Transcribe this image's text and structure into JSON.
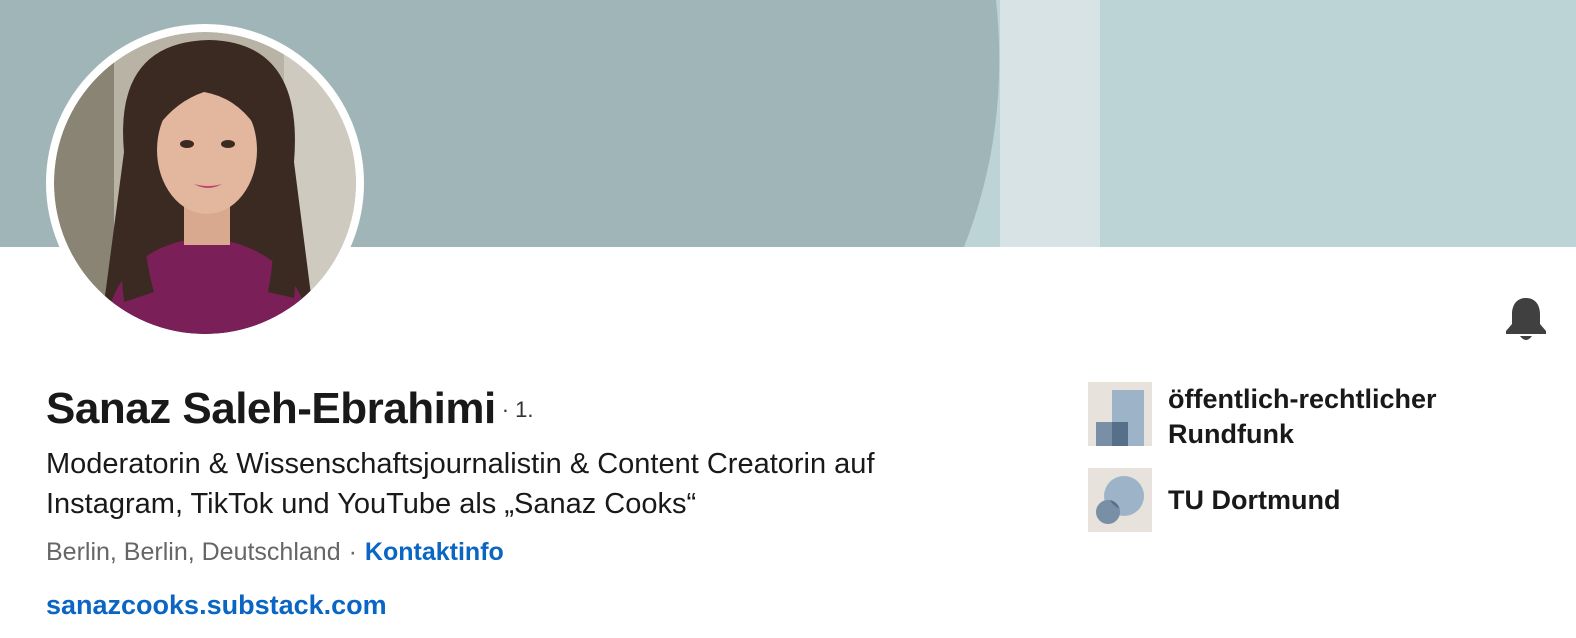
{
  "profile": {
    "name": "Sanaz Saleh-Ebrahimi",
    "connection_degree": "· 1.",
    "headline": "Moderatorin & Wissenschaftsjournalistin & Content Creatorin auf Instagram, TikTok und YouTube als „Sanaz Cooks“",
    "location": "Berlin, Berlin, Deutschland",
    "separator": "·",
    "contact_info_label": "Kontaktinfo",
    "website": "sanazcooks.substack.com"
  },
  "affiliations": [
    {
      "label": "öffentlich-rechtlicher Rundfunk",
      "icon": "company-logo-placeholder"
    },
    {
      "label": "TU Dortmund",
      "icon": "school-logo-placeholder"
    }
  ],
  "icons": {
    "notification": "bell-icon"
  },
  "colors": {
    "banner_dark": "#a0b5b8",
    "banner_light": "#bdd4d7",
    "banner_mid": "#d7e3e4",
    "link": "#0a66c2",
    "text": "#191919",
    "muted": "#666666"
  }
}
